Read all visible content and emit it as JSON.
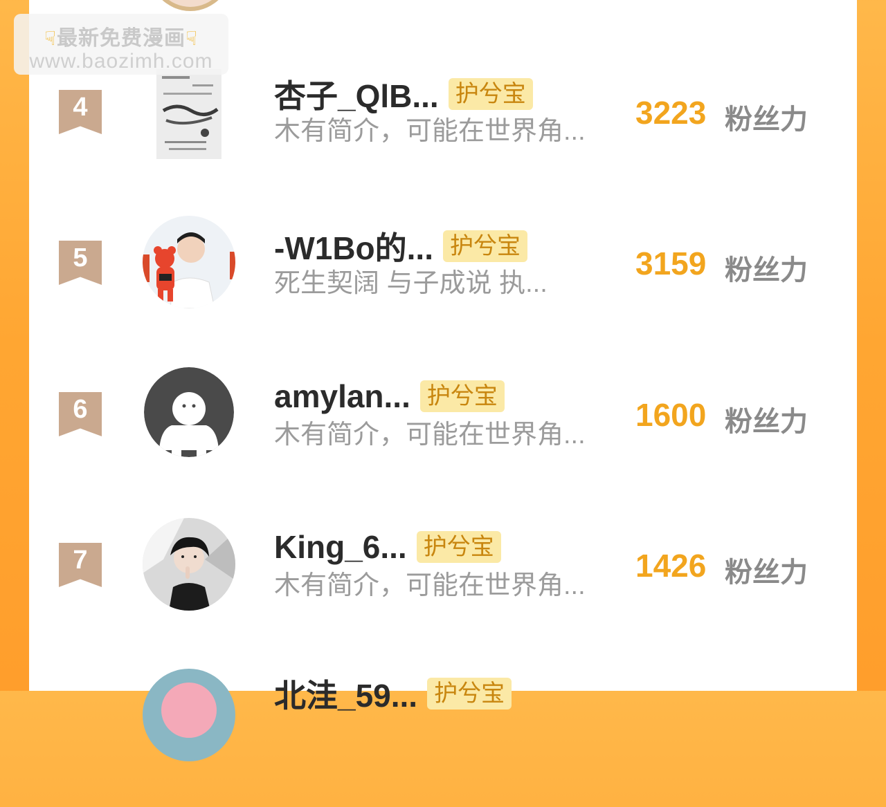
{
  "watermark": {
    "line1": "最新免费漫画",
    "line2": "www.baozimh.com",
    "hand_icon": "pointing-down-hand-icon"
  },
  "badge_label": "护兮宝",
  "unit_label": "粉丝力",
  "rows": [
    {
      "rank": "4",
      "name": "杏子_QlB...",
      "bio": "木有简介，可能在世界角...",
      "fans": "3223",
      "avatar": "calligraphy-poster-avatar"
    },
    {
      "rank": "5",
      "name": "-W1Bo的...",
      "bio": "死生契阔 与子成说 执...",
      "fans": "3159",
      "avatar": "man-with-bear-plush-avatar"
    },
    {
      "rank": "6",
      "name": "amylan...",
      "bio": "木有简介，可能在世界角...",
      "fans": "1600",
      "avatar": "default-person-avatar"
    },
    {
      "rank": "7",
      "name": "King_6...",
      "bio": "木有简介，可能在世界角...",
      "fans": "1426",
      "avatar": "anime-boy-avatar"
    },
    {
      "rank": "",
      "name": "北洼_59...",
      "bio": "",
      "fans": "",
      "avatar": "pink-hair-anime-avatar"
    }
  ],
  "colors": {
    "background_orange": "#ffa632",
    "count_color": "#f2a51e",
    "badge_bg": "#fbe9a6",
    "badge_text": "#c8860f",
    "rank_ribbon": "#caa98f"
  }
}
